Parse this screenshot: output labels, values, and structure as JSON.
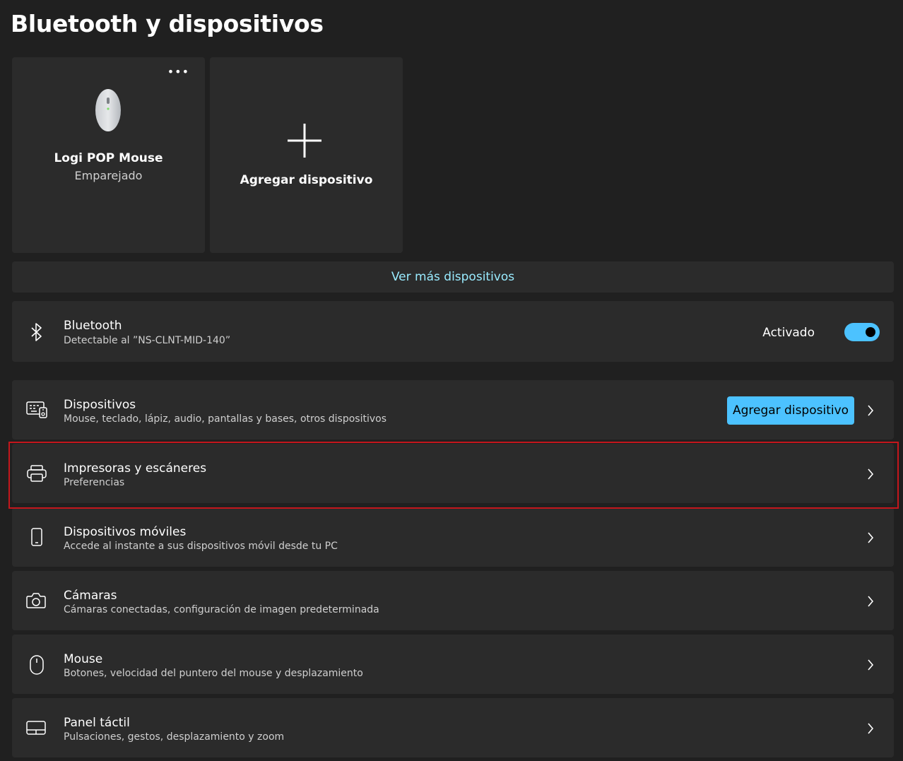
{
  "page": {
    "title": "Bluetooth y dispositivos"
  },
  "tiles": {
    "mouse": {
      "name": "Logi POP Mouse",
      "status": "Emparejado",
      "more_icon": "more-icon",
      "image": "mouse-device-image"
    },
    "add": {
      "label": "Agregar dispositivo",
      "icon": "plus-icon"
    }
  },
  "more_devices": {
    "label": "Ver más dispositivos"
  },
  "bluetooth": {
    "title": "Bluetooth",
    "subtitle": "Detectable al ”NS-CLNT-MID-140”",
    "toggle_label": "Activado",
    "toggle_on": true,
    "icon": "bluetooth-icon"
  },
  "rows": [
    {
      "title": "Dispositivos",
      "subtitle": "Mouse, teclado, lápiz, audio, pantallas y bases, otros dispositivos",
      "icon": "devices-icon",
      "button": "Agregar dispositivo"
    },
    {
      "title": "Impresoras y escáneres",
      "subtitle": "Preferencias",
      "icon": "printer-icon",
      "highlighted": true
    },
    {
      "title": "Dispositivos móviles",
      "subtitle": "Accede al instante a sus dispositivos móvil desde tu PC",
      "icon": "phone-icon"
    },
    {
      "title": "Cámaras",
      "subtitle": "Cámaras conectadas, configuración de imagen predeterminada",
      "icon": "camera-icon"
    },
    {
      "title": "Mouse",
      "subtitle": "Botones, velocidad del puntero del mouse y desplazamiento",
      "icon": "mouse-icon"
    },
    {
      "title": "Panel táctil",
      "subtitle": "Pulsaciones, gestos, desplazamiento y zoom",
      "icon": "touchpad-icon"
    }
  ],
  "colors": {
    "background": "#202020",
    "card": "#2b2b2b",
    "accent": "#4cc2ff",
    "link": "#99ebff",
    "highlight": "#c4161c"
  }
}
